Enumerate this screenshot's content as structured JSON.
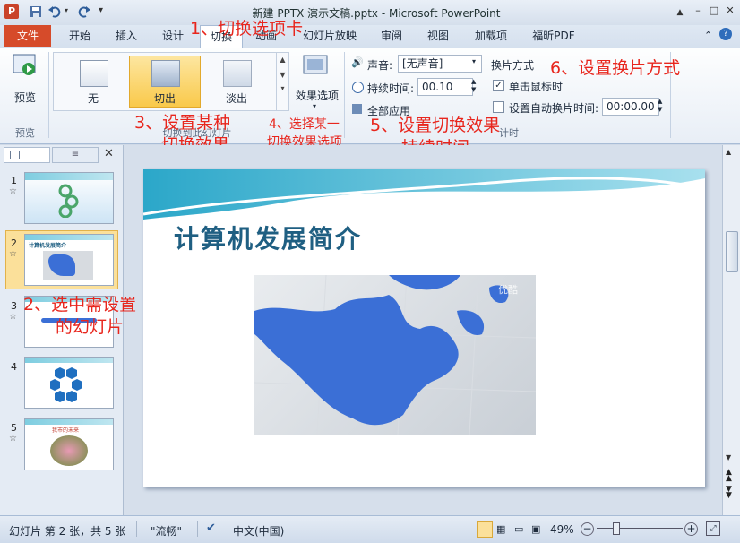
{
  "window": {
    "title": "新建 PPTX 演示文稿.pptx - Microsoft PowerPoint",
    "app_icon": "P",
    "undo_icon": "undo-icon",
    "redo_icon": "redo-icon",
    "save_icon": "save-icon",
    "controls": [
      "–",
      "□",
      "✕"
    ]
  },
  "tabs": [
    "文件",
    "开始",
    "插入",
    "设计",
    "切换",
    "动画",
    "幻灯片放映",
    "审阅",
    "视图",
    "加载项",
    "福昕PDF"
  ],
  "ribbon": {
    "preview_label": "预览",
    "preview_group_label": "预览",
    "transitions": [
      "无",
      "切出",
      "淡出"
    ],
    "group_label": "切换到此幻灯片",
    "effect_options_label": "效果选项",
    "sound_label": "声音:",
    "sound_value": "[无声音]",
    "duration_label": "持续时间:",
    "duration_value": "00.10",
    "apply_all_label": "全部应用",
    "advance_title": "换片方式",
    "on_click_label": "单击鼠标时",
    "auto_after_label": "设置自动换片时间:",
    "auto_after_value": "00:00.00",
    "timing_group_label": "计时"
  },
  "annotations": {
    "a1": "1、切换选项卡",
    "a2_line1": "2、选中需设置",
    "a2_line2": "的幻灯片",
    "a3_line1": "3、设置某种",
    "a3_line2": "切换效果",
    "a4_line1": "4、选择某一",
    "a4_line2": "切换效果选项",
    "a5_line1": "5、设置切换效果",
    "a5_line2": "持续时间",
    "a6": "6、设置换片方式"
  },
  "thumbnails": [
    {
      "num": "1",
      "star": "☆"
    },
    {
      "num": "2",
      "star": "☆",
      "title": "计算机发展简介"
    },
    {
      "num": "3",
      "star": "☆"
    },
    {
      "num": "4"
    },
    {
      "num": "5",
      "star": "☆",
      "title": "我市的未来"
    }
  ],
  "slide": {
    "title": "计算机发展简介",
    "image_watermark": "优酷"
  },
  "status": {
    "slide_info": "幻灯片 第 2 张，共 5 张",
    "theme": "\"流畅\"",
    "language": "中文(中国)",
    "zoom": "49%"
  },
  "colors": {
    "file_tab": "#d64b2a",
    "annotation": "#e8261d",
    "selected_transition": "#f9c94a",
    "slide_title": "#1f5f82",
    "map_blue": "#3b6fd6"
  }
}
